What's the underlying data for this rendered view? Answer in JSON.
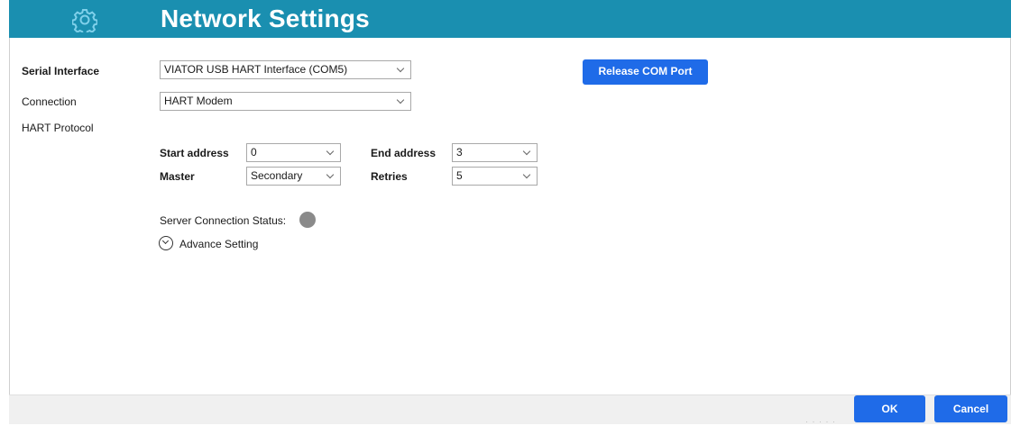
{
  "header": {
    "title": "Network Settings",
    "icon": "gear-icon",
    "background": "#1a8fb0"
  },
  "form": {
    "serial_interface": {
      "label": "Serial Interface",
      "value": "VIATOR USB HART Interface (COM5)"
    },
    "connection": {
      "label": "Connection",
      "value": "HART Modem"
    },
    "hart_protocol": {
      "label": "HART Protocol"
    },
    "start_address": {
      "label": "Start address",
      "value": "0"
    },
    "end_address": {
      "label": "End address",
      "value": "3"
    },
    "master": {
      "label": "Master",
      "value": "Secondary"
    },
    "retries": {
      "label": "Retries",
      "value": "5"
    }
  },
  "release_button": {
    "label": "Release COM Port"
  },
  "status": {
    "label": "Server Connection Status:",
    "indicator_color": "#8a8a8a"
  },
  "advance": {
    "label": "Advance Setting",
    "icon": "chevron-down-circle-icon"
  },
  "footer": {
    "ok_label": "OK",
    "cancel_label": "Cancel"
  },
  "colors": {
    "accent_button": "#1f6be8"
  }
}
